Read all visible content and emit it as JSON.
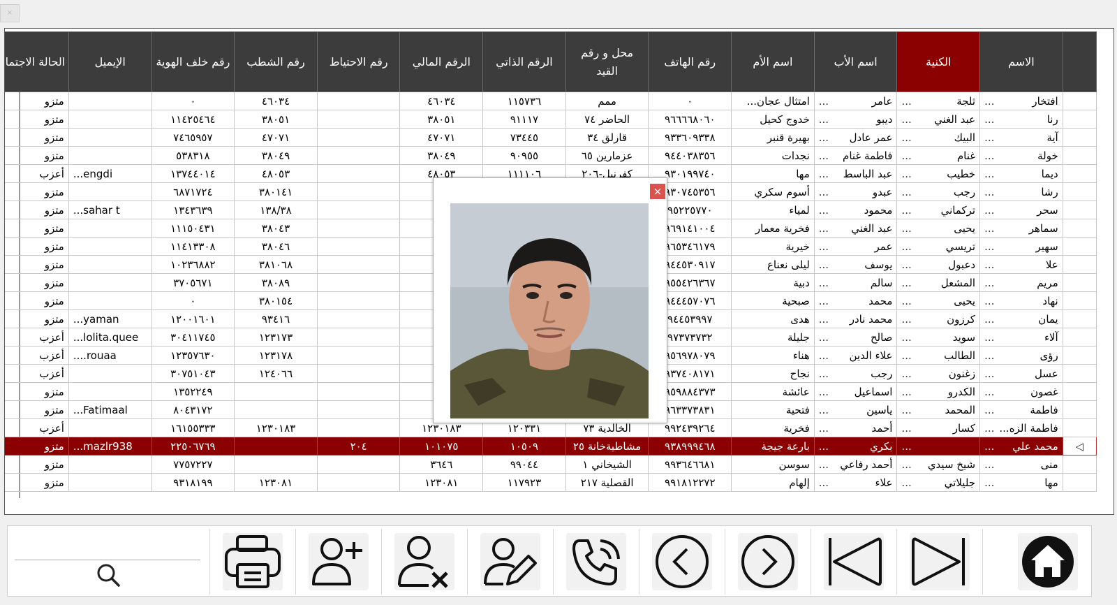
{
  "window": {
    "close_label": "×"
  },
  "grid": {
    "headers": [
      "الاسم",
      "الكنية",
      "اسم الأب",
      "اسم الأم",
      "رقم الهاتف",
      "محل و رقم القيد",
      "الرقم الذاتي",
      "الرقم المالي",
      "رقم الاحتياط",
      "رقم الشطب",
      "رقم خلف الهوية",
      "الإيميل",
      "الحالة الاجتماعية"
    ],
    "selected_header": "الكنية",
    "selected_row_index": 19,
    "rows": [
      {
        "name": "افتخار",
        "surname": "ثلجة",
        "father": "عامر",
        "mother": "امتثال عجان...",
        "phone": "٠",
        "registry": "ممم",
        "self_no": "١١٥٧٣٦",
        "fin_no": "٤٦٠٣٤",
        "reserve": "",
        "strike": "٤٦٠٣٤",
        "id_back": "٠",
        "email": "",
        "status": "متزو"
      },
      {
        "name": "رنا",
        "surname": "عبد الغني",
        "father": "ديبو",
        "mother": "خدوج كحيل",
        "phone": "٩٦٦٦٦٨٠٦٠",
        "registry": "الحاضر ٧٤",
        "self_no": "٩١١١٧",
        "fin_no": "٣٨٠٥١",
        "reserve": "",
        "strike": "٣٨٠٥١",
        "id_back": "١١٤٢٥٤٦٤",
        "email": "",
        "status": "متزو"
      },
      {
        "name": "آية",
        "surname": "البيك",
        "father": "عمر عادل",
        "mother": "بهيرة قنبر",
        "phone": "٩٣٣٦٠٩٣٣٨",
        "registry": "قارلق ٣٤",
        "self_no": "٧٣٤٤٥",
        "fin_no": "٤٧٠٧١",
        "reserve": "",
        "strike": "٤٧٠٧١",
        "id_back": "٧٤٦٥٩٥٧",
        "email": "",
        "status": "متزو"
      },
      {
        "name": "خولة",
        "surname": "غنام",
        "father": "فاطمة غنام",
        "mother": "نجدات",
        "phone": "٩٤٤٠٣٨٣٥٦",
        "registry": "عزمارين ٦٥",
        "self_no": "٩٠٩٥٥",
        "fin_no": "٣٨٠٤٩",
        "reserve": "",
        "strike": "٣٨٠٤٩",
        "id_back": "٥٣٨٣١٨",
        "email": "",
        "status": "متزو"
      },
      {
        "name": "ديما",
        "surname": "خطيب",
        "father": "عبد الباسط",
        "mother": "مها",
        "phone": "٩٣٠١٩٩٧٤٠",
        "registry": "كفرنبل-٢٠٦",
        "self_no": "١١١١٠٦",
        "fin_no": "٤٨٠٥٣",
        "reserve": "",
        "strike": "٤٨٠٥٣",
        "id_back": "١٣٧٤٤٠١٤",
        "email": "engdi...",
        "status": "أعزب"
      },
      {
        "name": "رشا",
        "surname": "رجب",
        "father": "عبدو",
        "mother": "أسوم سكري",
        "phone": "٩٣٠٧٤٥٣٥٦",
        "registry": "",
        "self_no": "",
        "fin_no": "٣٨",
        "reserve": "",
        "strike": "٣٨٠١٤١",
        "id_back": "٦٨٧١٧٢٤",
        "email": "",
        "status": "متزو"
      },
      {
        "name": "سحر",
        "surname": "تركماني",
        "father": "محمود",
        "mother": "لمياء",
        "phone": "٩٥٢٢٥٧٧٠",
        "registry": "",
        "self_no": "",
        "fin_no": "١١",
        "reserve": "",
        "strike": "١٣٨/٣٨",
        "id_back": "١٣٤٣٦٣٩",
        "email": "sahar t...",
        "status": "متزو"
      },
      {
        "name": "سماهر",
        "surname": "يحيى",
        "father": "عبد الغني",
        "mother": "فخرية معمار",
        "phone": "٩٦٩١٤١٠٠٤",
        "registry": "",
        "self_no": "",
        "fin_no": "٣",
        "reserve": "",
        "strike": "٣٨٠٤٣",
        "id_back": "١١١٥٠٤٣١",
        "email": "",
        "status": "متزو"
      },
      {
        "name": "سهير",
        "surname": "تريسي",
        "father": "عمر",
        "mother": "خيرية",
        "phone": "٩٦٥٣٤٦١٧٩",
        "registry": "",
        "self_no": "",
        "fin_no": "٣",
        "reserve": "",
        "strike": "٣٨٠٤٦",
        "id_back": "١١٤١٣٣٠٨",
        "email": "",
        "status": "متزو"
      },
      {
        "name": "علا",
        "surname": "دعبول",
        "father": "يوسف",
        "mother": "ليلى نعناع",
        "phone": "٩٤٤٥٣٠٩١٧",
        "registry": "",
        "self_no": "",
        "fin_no": "٣٨",
        "reserve": "",
        "strike": "٣٨١٠٦٨",
        "id_back": "١٠٢٣٦٨٨٢",
        "email": "",
        "status": "متزو"
      },
      {
        "name": "مريم",
        "surname": "المشعل",
        "father": "سالم",
        "mother": "دبية",
        "phone": "٩٥٥٤٢٦٣٦٧",
        "registry": "",
        "self_no": "",
        "fin_no": "٣",
        "reserve": "",
        "strike": "٣٨٠٨٩",
        "id_back": "٣٧٠٥٦٧١",
        "email": "",
        "status": "متزو"
      },
      {
        "name": "نهاد",
        "surname": "يحيى",
        "father": "محمد",
        "mother": "صبحية",
        "phone": "٩٤٤٤٥٧٠٧٦",
        "registry": "",
        "self_no": "",
        "fin_no": "٣",
        "reserve": "",
        "strike": "٣٨٠١٥٤",
        "id_back": "٠",
        "email": "",
        "status": "متزو"
      },
      {
        "name": "يمان",
        "surname": "كرزون",
        "father": "محمد نادر",
        "mother": "هدى",
        "phone": "٩٤٤٥٣٩٩٧",
        "registry": "",
        "self_no": "",
        "fin_no": "٣",
        "reserve": "",
        "strike": "٩٣٤١٦",
        "id_back": "١٢٠٠١٦٠١",
        "email": "yaman...",
        "status": "متزو"
      },
      {
        "name": "آلاء",
        "surname": "سويد",
        "father": "صالح",
        "mother": "جليلة",
        "phone": "٩٧٣٧٣٧٣٢",
        "registry": "",
        "self_no": "",
        "fin_no": "١٢",
        "reserve": "",
        "strike": "١٢٣١٧٣",
        "id_back": "٣٠٤١١٧٤٥",
        "email": "lolita.quee...",
        "status": "أعزب"
      },
      {
        "name": "رؤى",
        "surname": "الطالب",
        "father": "علاء الدين",
        "mother": "هناء",
        "phone": "٩٥٦٩٧٨٠٧٩",
        "registry": "",
        "self_no": "",
        "fin_no": "١٢",
        "reserve": "",
        "strike": "١٢٣١٧٨",
        "id_back": "١٢٣٥٧٦٣٠",
        "email": "rouaa....",
        "status": "أعزب"
      },
      {
        "name": "عسل",
        "surname": "زغنون",
        "father": "رجب",
        "mother": "نجاح",
        "phone": "٩٣٧٤٠٨١٧١",
        "registry": "",
        "self_no": "",
        "fin_no": "١٢",
        "reserve": "",
        "strike": "١٢٤٠٦٦",
        "id_back": "٣٠٧٥١٠٤٣",
        "email": "",
        "status": "أعزب"
      },
      {
        "name": "غصون",
        "surname": "الكدرو",
        "father": "اسماعيل",
        "mother": "عائشة",
        "phone": "٩٥٩٨٨٤٣٧٣",
        "registry": "",
        "self_no": "",
        "fin_no": "٣٤",
        "reserve": "",
        "strike": "",
        "id_back": "١٣٥٢٢٤٩",
        "email": "",
        "status": "متزو"
      },
      {
        "name": "فاطمة",
        "surname": "المحمد",
        "father": "ياسين",
        "mother": "فتحية",
        "phone": "٩٦٣٣٧٣٨٣١",
        "registry": "",
        "self_no": "",
        "fin_no": "١٢",
        "reserve": "",
        "strike": "",
        "id_back": "٨٠٤٣١٧٢",
        "email": "Fatimaal...",
        "status": "متزو"
      },
      {
        "name": "فاطمة الزه...",
        "surname": "كسار",
        "father": "أحمد",
        "mother": "فخرية",
        "phone": "٩٩٢٤٣٩٢٦٤",
        "registry": "الخالدية ٧٣",
        "self_no": "١٢٠٣٣١",
        "fin_no": "١٢٣٠١٨٣",
        "reserve": "",
        "strike": "١٢٣٠١٨٣",
        "id_back": "١٦١٥٥٣٣٣",
        "email": "",
        "status": "أعزب"
      },
      {
        "name": "محمد علي",
        "surname": "",
        "father": "بكري",
        "mother": "بارعة جيجة",
        "phone": "٩٣٨٩٩٩٤٦٨",
        "registry": "مشاطيةخانة ٢٥",
        "self_no": "١٠٥٠٩",
        "fin_no": "١٠١٠٧٥",
        "reserve": "٢٠٤",
        "strike": "",
        "id_back": "٢٢٥٠٦٧٦٩",
        "email": "mazlr938...",
        "status": "متزو"
      },
      {
        "name": "منى",
        "surname": "شيخ سيدي",
        "father": "أحمد رفاعي",
        "mother": "سوسن",
        "phone": "٩٩٣٦٤٦٦٨١",
        "registry": "الشيخاني ١",
        "self_no": "٩٩٠٤٤",
        "fin_no": "٣٦٤٦",
        "reserve": "",
        "strike": "",
        "id_back": "٧٧٥٧٢٢٧",
        "email": "",
        "status": "متزو"
      },
      {
        "name": "مها",
        "surname": "جليلاتي",
        "father": "علاء",
        "mother": "إلهام",
        "phone": "٩٩١٨١٢٢٧٢",
        "registry": "القصلية ٢١٧",
        "self_no": "١١٧٩٢٣",
        "fin_no": "١٢٣٠٨١",
        "reserve": "",
        "strike": "١٢٣٠٨١",
        "id_back": "٩٣١٨١٩٩",
        "email": "",
        "status": "متزو"
      }
    ]
  },
  "toolbar": {
    "search_value": "",
    "search_icon": "search-icon",
    "buttons": [
      "home-icon",
      "last-icon",
      "first-icon",
      "next-icon",
      "previous-icon",
      "call-icon",
      "edit-user-icon",
      "delete-user-icon",
      "add-user-icon",
      "print-icon"
    ]
  },
  "popup": {
    "close_label": "×"
  },
  "colors": {
    "header_bg": "#3c3c3c",
    "accent": "#8b0000"
  }
}
